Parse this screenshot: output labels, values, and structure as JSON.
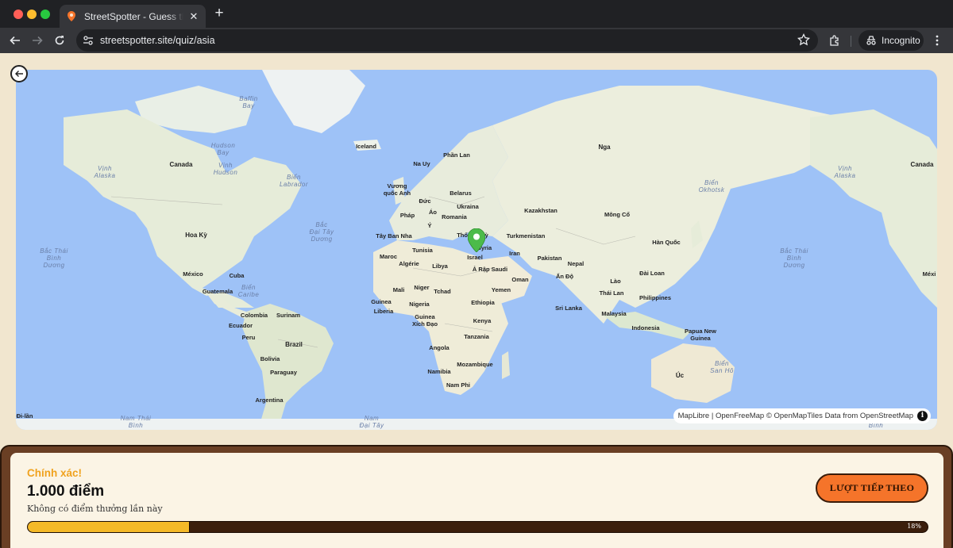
{
  "browser": {
    "tab_title": "StreetSpotter - Guess the street",
    "tab_close": "✕",
    "new_tab": "+",
    "url": "streetspotter.site/quiz/asia",
    "incognito_label": "Incognito"
  },
  "map": {
    "attribution_maplibre": "MapLibre",
    "attribution_sep": " | ",
    "attribution_ofm": "OpenFreeMap",
    "attribution_omt": " © OpenMapTiles ",
    "attribution_data": "Data from ",
    "attribution_osm": "OpenStreetMap",
    "info_icon": "i",
    "marker_color": "#4cbb4a",
    "labels": {
      "baffin": "Baffin\nBay",
      "hudson_bay": "Hudson\nBay",
      "vinh_hudson": "Vịnh\nHudson",
      "vinh_alaska_w": "Vịnh\nAlaska",
      "canada_w": "Canada",
      "bien_labrador": "Biển\nLabrador",
      "iceland": "Iceland",
      "phan_lan": "Phần Lan",
      "na_uy": "Na Uy",
      "nga": "Nga",
      "vuong_quoc_anh": "Vương\nquốc Anh",
      "duc": "Đức",
      "belarus": "Belarus",
      "ukraina": "Ukraina",
      "phap": "Pháp",
      "ao": "Áo",
      "romania": "Romania",
      "y": "Ý",
      "kazakhstan": "Kazakhstan",
      "mong_co": "Mông Cổ",
      "bien_okhotsk": "Biển\nOkhotsk",
      "bac_dai_tay_duong": "Bắc\nĐại Tây\nDương",
      "hoa_ky": "Hoa Kỳ",
      "tay_ban_nha": "Tây Ban Nha",
      "tho_nhi_ky": "Thổ Nhĩ Kỳ",
      "turkmenistan": "Turkmenistan",
      "han_quoc": "Hàn Quốc",
      "bac_thai_binh_duong_w": "Bắc Thái\nBình\nDương",
      "bac_thai_binh_duong_e": "Bắc Thái\nBình\nDương",
      "tunisia": "Tunisia",
      "syria": "Syria",
      "israel": "Israel",
      "iran": "Iran",
      "maroc": "Maroc",
      "algerie": "Algérie",
      "libya": "Libya",
      "a_rap_saudi": "Ả Rập Saudi",
      "pakistan": "Pakistan",
      "nepal": "Nepal",
      "mexico": "México",
      "cuba": "Cuba",
      "an_do": "Ấn Độ",
      "dai_loan": "Đài Loan",
      "oman": "Oman",
      "guatemala": "Guatemala",
      "bien_caribe": "Biển\nCaribe",
      "mali": "Mali",
      "niger": "Niger",
      "tchad": "Tchad",
      "yemen": "Yemen",
      "lao": "Lào",
      "thai_lan": "Thái Lan",
      "philippines": "Philippines",
      "guinea": "Guinea",
      "nigeria": "Nigeria",
      "ethiopia": "Ethiopia",
      "sri_lanka": "Sri Lanka",
      "liberia": "Liberia",
      "colombia": "Colombia",
      "suriname": "Surinam",
      "guinea_xd": "Guinea\nXích Đạo",
      "malaysia": "Malaysia",
      "kenya": "Kenya",
      "ecuador": "Ecuador",
      "indonesia": "Indonesia",
      "papua": "Papua New\nGuinea",
      "peru": "Peru",
      "brazil": "Brazil",
      "tanzania": "Tanzania",
      "angola": "Angola",
      "bolivia": "Bolivia",
      "paraguay": "Paraguay",
      "mozambique": "Mozambique",
      "namibia": "Namibia",
      "uc": "Úc",
      "bien_san_ho": "Biển\nSan Hô",
      "nam_phi": "Nam Phi",
      "argentina": "Argentina",
      "di_lan": "Đi-lần",
      "nam_thai_binh": "Nam Thái\nBình",
      "nam_dai_tay": "Nam\nĐại Tây",
      "binh_e": "Bình",
      "canada_e": "Canada",
      "vinh_alaska_e": "Vịnh\nAlaska",
      "mexico_e": "Méxi"
    }
  },
  "result": {
    "verdict": "Chính xác!",
    "points": "1.000 điểm",
    "bonus_text": "Không có điểm thưởng lần này",
    "next_button": "LƯỢT TIẾP THEO",
    "progress_percent": 18,
    "progress_label": "18%",
    "colors": {
      "verdict": "#f0a21e",
      "progress_fill": "#f4b928",
      "next_button": "#f5742a"
    }
  }
}
